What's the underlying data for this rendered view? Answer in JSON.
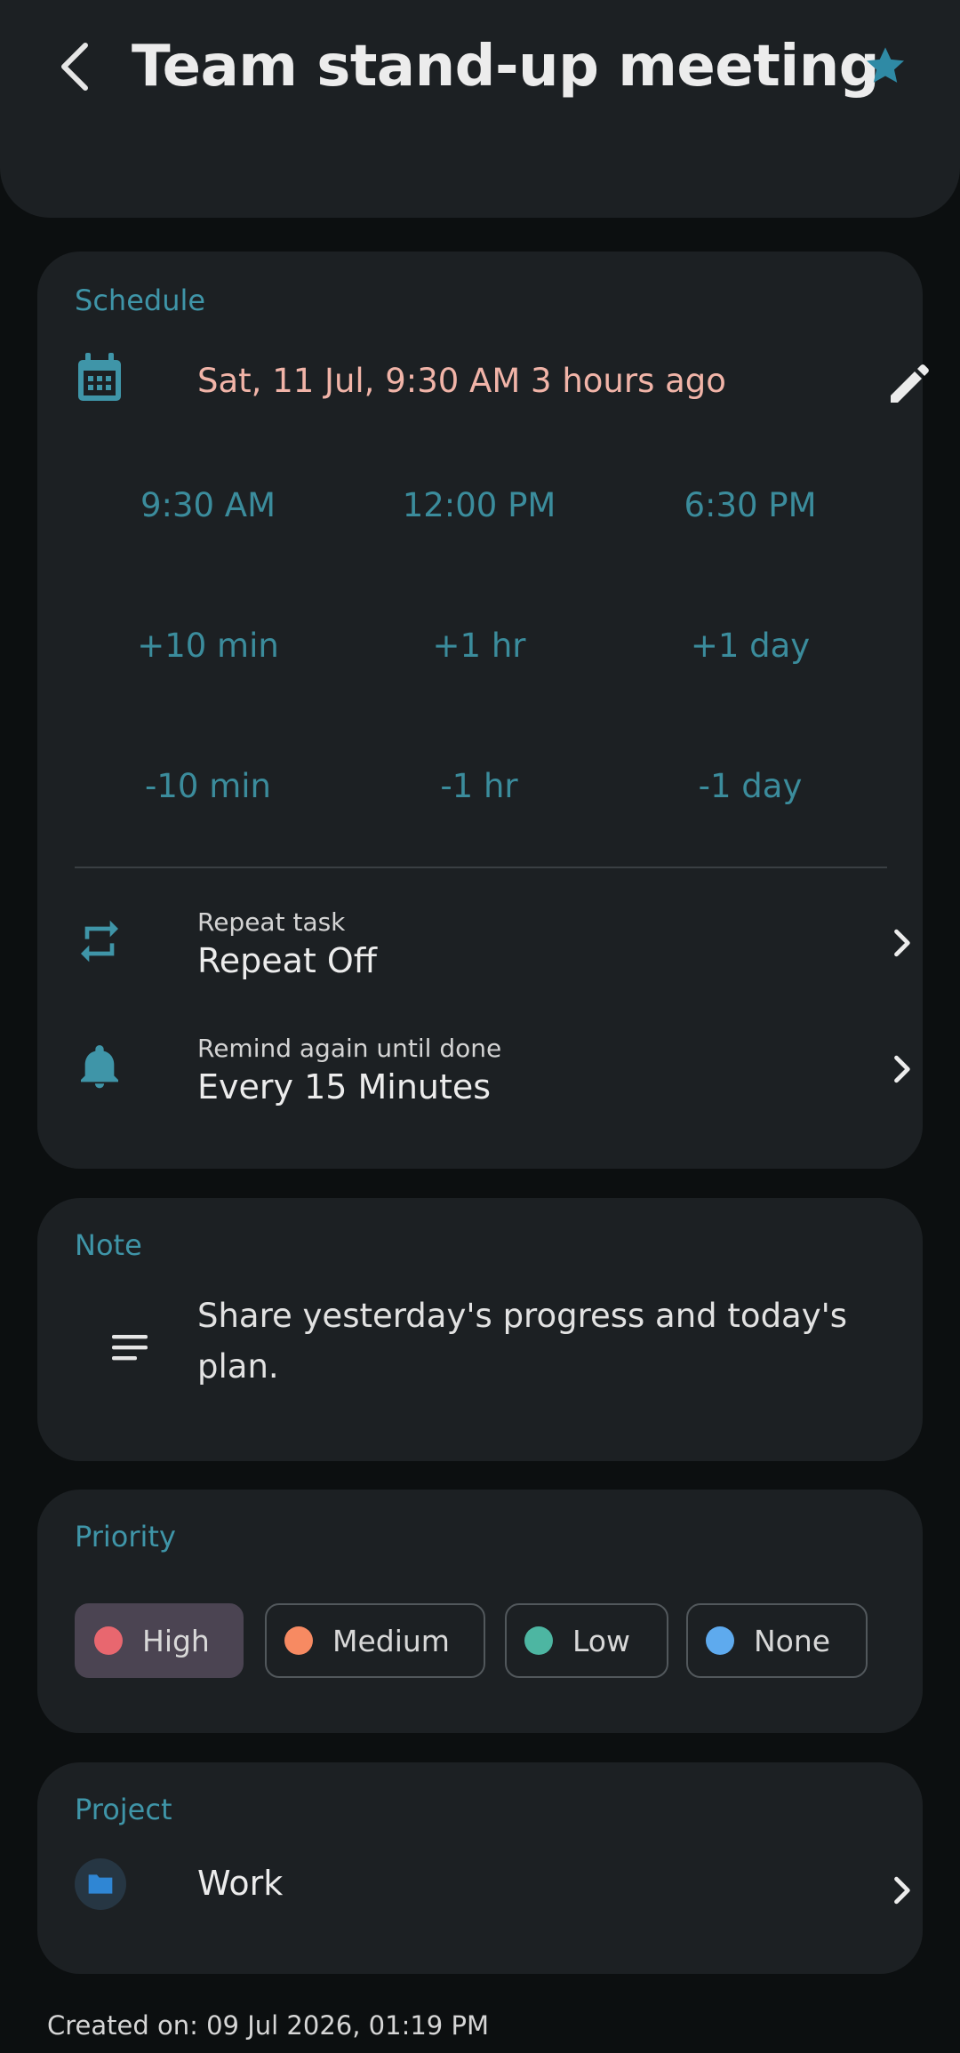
{
  "header": {
    "title": "Team stand-up meeting",
    "back_icon": "chevron-left-icon",
    "star_icon": "star-icon",
    "accent": "#3f95a8"
  },
  "schedule": {
    "label": "Schedule",
    "datetime": "Sat, 11 Jul, 9:30 AM 3 hours ago",
    "quick_times": [
      "9:30 AM",
      "12:00 PM",
      "6:30 PM"
    ],
    "plus_adjust": [
      "+10 min",
      "+1 hr",
      "+1 day"
    ],
    "minus_adjust": [
      "-10 min",
      "-1 hr",
      "-1 day"
    ],
    "repeat": {
      "label": "Repeat task",
      "value": "Repeat Off"
    },
    "remind": {
      "label": "Remind again until done",
      "value": "Every 15 Minutes"
    }
  },
  "note": {
    "label": "Note",
    "text": "Share yesterday's progress and today's plan."
  },
  "priority": {
    "label": "Priority",
    "selected": "High",
    "options": [
      {
        "label": "High",
        "color": "#e8676f"
      },
      {
        "label": "Medium",
        "color": "#f78a62"
      },
      {
        "label": "Low",
        "color": "#4db6a2"
      },
      {
        "label": "None",
        "color": "#5eaaee"
      }
    ]
  },
  "project": {
    "label": "Project",
    "name": "Work",
    "icon_color": "#2f86d4"
  },
  "footer": {
    "created": "Created on: 09 Jul 2026, 01:19 PM"
  }
}
